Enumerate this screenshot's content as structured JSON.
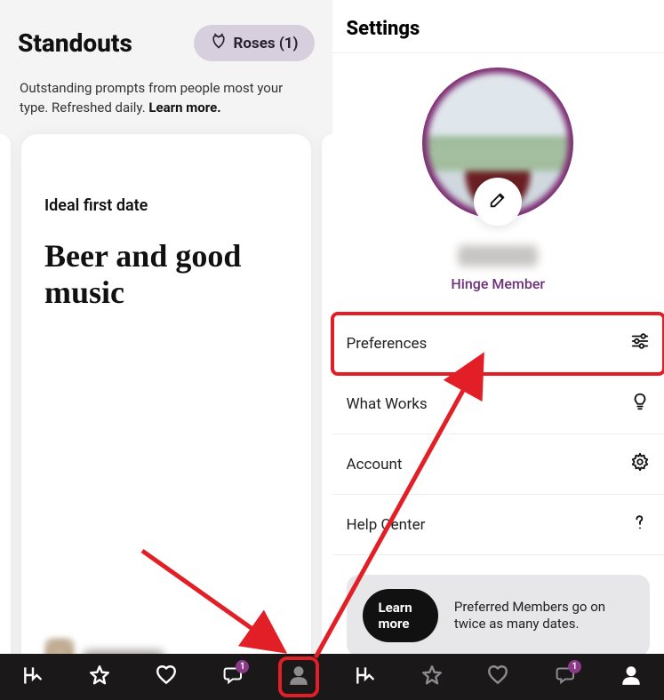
{
  "left": {
    "title": "Standouts",
    "roses_label": "Roses (1)",
    "subtext_part1": "Outstanding prompts from people most your type. Refreshed daily. ",
    "subtext_learn": "Learn more.",
    "card": {
      "prompt": "Ideal first date",
      "answer": "Beer and good music"
    }
  },
  "right": {
    "title": "Settings",
    "member_label": "Hinge Member",
    "menu": [
      {
        "label": "Preferences",
        "icon": "sliders-icon",
        "highlight": true
      },
      {
        "label": "What Works",
        "icon": "bulb-icon",
        "highlight": false
      },
      {
        "label": "Account",
        "icon": "gear-icon",
        "highlight": false
      },
      {
        "label": "Help Center",
        "icon": "help-icon",
        "highlight": false
      }
    ],
    "learn_card": {
      "button": "Learn more",
      "text": "Preferred Members go on twice as many dates."
    }
  },
  "nav": {
    "badge_left": "1",
    "badge_right": "1"
  }
}
